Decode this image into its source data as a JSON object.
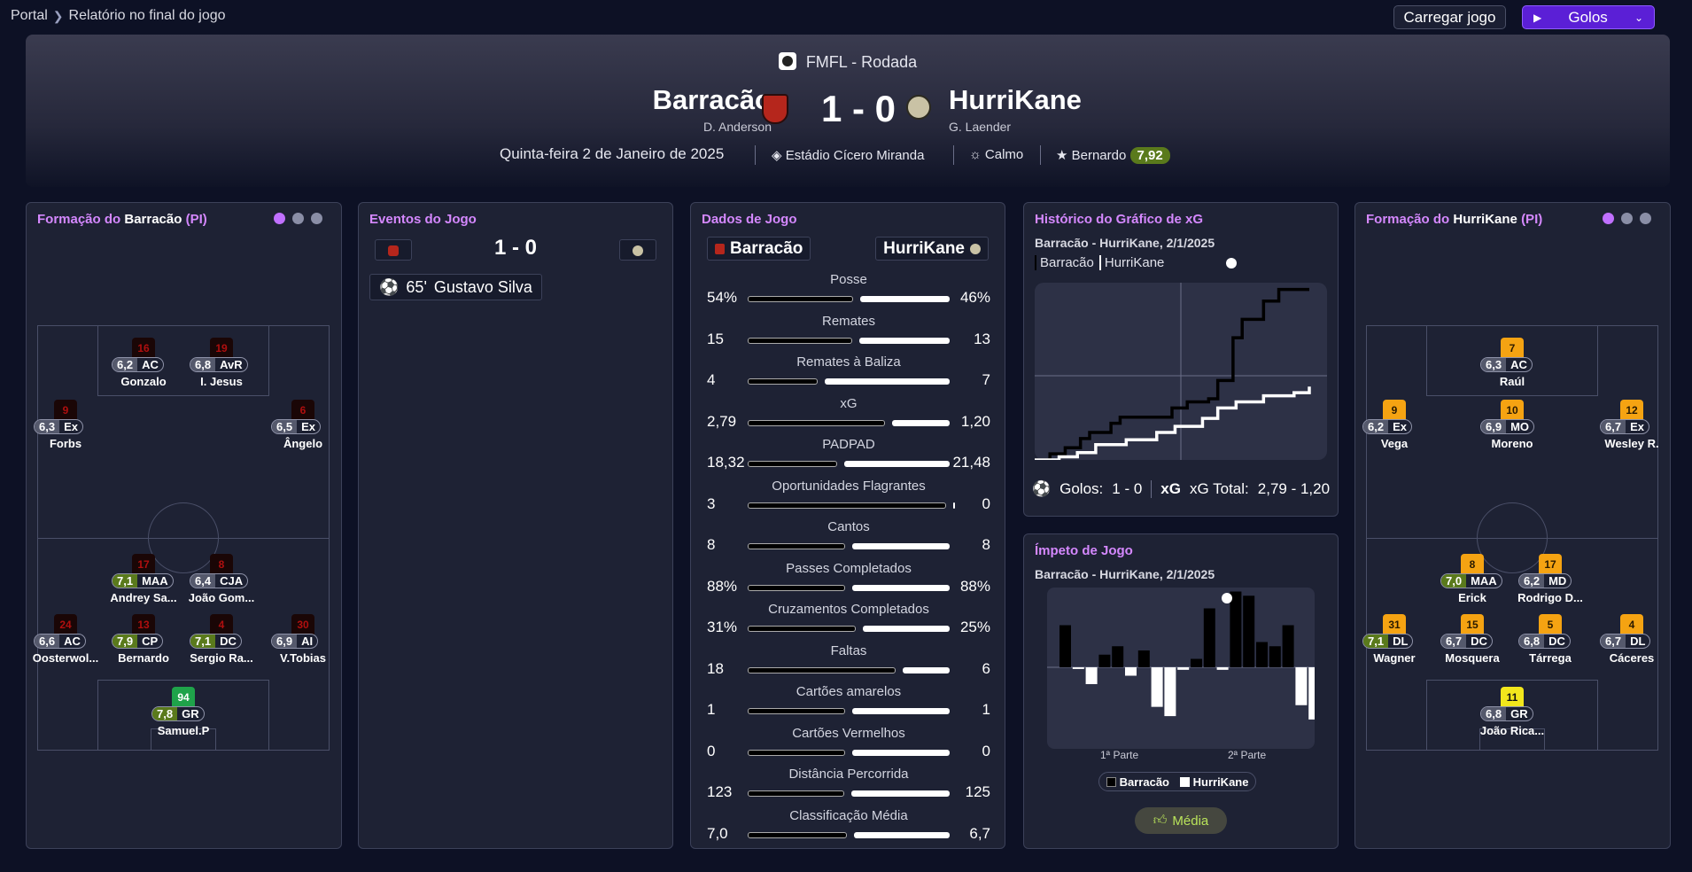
{
  "breadcrumb": {
    "root": "Portal",
    "current": "Relatório no final do jogo"
  },
  "toolbar": {
    "load_label": "Carregar jogo",
    "goals_label": "Golos"
  },
  "match": {
    "competition": "FMFL - Rodada",
    "home": {
      "name": "Barracão",
      "manager": "D. Anderson"
    },
    "away": {
      "name": "HurriKane",
      "manager": "G. Laender"
    },
    "score": "1 - 0",
    "date": "Quinta-feira 2 de Janeiro de 2025",
    "stadium": "Estádio Cícero Miranda",
    "weather": "Calmo",
    "potm": "Bernardo",
    "potm_rating": "7,92"
  },
  "colors": {
    "accent": "#5b1fd6",
    "title_purple": "#d588ff",
    "good_rating": "#5a7a1c"
  },
  "home_lineup": {
    "title_prefix": "Formação do",
    "team": "Barracão",
    "suffix": "(PI)",
    "players": [
      {
        "num": "16",
        "rating": "6,2",
        "pos": "AC",
        "name": "Gonzalo",
        "good": false
      },
      {
        "num": "19",
        "rating": "6,8",
        "pos": "AvR",
        "name": "I. Jesus",
        "good": false
      },
      {
        "num": "9",
        "rating": "6,3",
        "pos": "Ex",
        "name": "Forbs",
        "good": false
      },
      {
        "num": "6",
        "rating": "6,5",
        "pos": "Ex",
        "name": "Ângelo",
        "good": false
      },
      {
        "num": "17",
        "rating": "7,1",
        "pos": "MAA",
        "name": "Andrey Sa...",
        "good": true
      },
      {
        "num": "8",
        "rating": "6,4",
        "pos": "CJA",
        "name": "João Gom...",
        "good": false
      },
      {
        "num": "24",
        "rating": "6,6",
        "pos": "AC",
        "name": "Oosterwol...",
        "good": false
      },
      {
        "num": "13",
        "rating": "7,9",
        "pos": "CP",
        "name": "Bernardo",
        "good": true
      },
      {
        "num": "4",
        "rating": "7,1",
        "pos": "DC",
        "name": "Sergio Ra...",
        "good": true
      },
      {
        "num": "30",
        "rating": "6,9",
        "pos": "AI",
        "name": "V.Tobias",
        "good": false
      },
      {
        "num": "94",
        "rating": "7,8",
        "pos": "GR",
        "name": "Samuel.P",
        "good": true
      }
    ]
  },
  "away_lineup": {
    "title_prefix": "Formação do",
    "team": "HurriKane",
    "suffix": "(PI)",
    "players": [
      {
        "num": "7",
        "rating": "6,3",
        "pos": "AC",
        "name": "Raúl",
        "good": false
      },
      {
        "num": "9",
        "rating": "6,2",
        "pos": "Ex",
        "name": "Vega",
        "good": false
      },
      {
        "num": "10",
        "rating": "6,9",
        "pos": "MO",
        "name": "Moreno",
        "good": false
      },
      {
        "num": "12",
        "rating": "6,7",
        "pos": "Ex",
        "name": "Wesley R.",
        "good": false
      },
      {
        "num": "8",
        "rating": "7,0",
        "pos": "MAA",
        "name": "Erick",
        "good": true
      },
      {
        "num": "17",
        "rating": "6,2",
        "pos": "MD",
        "name": "Rodrigo D...",
        "good": false
      },
      {
        "num": "31",
        "rating": "7,1",
        "pos": "DL",
        "name": "Wagner",
        "good": true
      },
      {
        "num": "15",
        "rating": "6,7",
        "pos": "DC",
        "name": "Mosquera",
        "good": false
      },
      {
        "num": "5",
        "rating": "6,8",
        "pos": "DC",
        "name": "Tárrega",
        "good": false
      },
      {
        "num": "4",
        "rating": "6,7",
        "pos": "DL",
        "name": "Cáceres",
        "good": false
      },
      {
        "num": "11",
        "rating": "6,8",
        "pos": "GR",
        "name": "João Rica...",
        "good": false
      }
    ]
  },
  "events": {
    "title": "Eventos do Jogo",
    "score": "1 - 0",
    "items": [
      {
        "minute": "65'",
        "player": "Gustavo Silva"
      }
    ]
  },
  "stats": {
    "title": "Dados de Jogo",
    "home": "Barracão",
    "away": "HurriKane",
    "rows": [
      {
        "label": "Posse",
        "home": "54%",
        "away": "46%",
        "h": 54,
        "a": 46
      },
      {
        "label": "Remates",
        "home": "15",
        "away": "13",
        "h": 15,
        "a": 13
      },
      {
        "label": "Remates à Baliza",
        "home": "4",
        "away": "7",
        "h": 4,
        "a": 7
      },
      {
        "label": "xG",
        "home": "2,79",
        "away": "1,20",
        "h": 2.79,
        "a": 1.2
      },
      {
        "label": "PADPAD",
        "home": "18,32",
        "away": "21,48",
        "h": 18.32,
        "a": 21.48
      },
      {
        "label": "Oportunidades Flagrantes",
        "home": "3",
        "away": "0",
        "h": 3,
        "a": 0
      },
      {
        "label": "Cantos",
        "home": "8",
        "away": "8",
        "h": 8,
        "a": 8
      },
      {
        "label": "Passes Completados",
        "home": "88%",
        "away": "88%",
        "h": 88,
        "a": 88
      },
      {
        "label": "Cruzamentos Completados",
        "home": "31%",
        "away": "25%",
        "h": 31,
        "a": 25
      },
      {
        "label": "Faltas",
        "home": "18",
        "away": "6",
        "h": 18,
        "a": 6
      },
      {
        "label": "Cartões amarelos",
        "home": "1",
        "away": "1",
        "h": 1,
        "a": 1
      },
      {
        "label": "Cartões Vermelhos",
        "home": "0",
        "away": "0",
        "h": 0,
        "a": 0
      },
      {
        "label": "Distância Percorrida",
        "home": "123",
        "away": "125",
        "h": 123,
        "a": 125
      },
      {
        "label": "Classificação Média",
        "home": "7,0",
        "away": "6,7",
        "h": 7.0,
        "a": 6.7
      }
    ]
  },
  "xg_chart": {
    "title": "Histórico do Gráfico de xG",
    "subtitle": "Barracão - HurriKane, 2/1/2025",
    "legend": [
      "Barracão",
      "HurriKane"
    ],
    "footer_goals_label": "Golos:",
    "footer_goals": "1 - 0",
    "footer_xg_label": "xG Total:",
    "footer_xg": "2,79 - 1,20"
  },
  "momentum": {
    "title": "Ímpeto de Jogo",
    "subtitle": "Barracão - HurriKane, 2/1/2025",
    "half1": "1ª Parte",
    "half2": "2ª Parte",
    "legend": [
      "Barracão",
      "HurriKane"
    ],
    "button": "Média"
  },
  "chart_data": [
    {
      "type": "line",
      "title": "Histórico do Gráfico de xG",
      "series": [
        {
          "name": "Barracão",
          "x": [
            0,
            5,
            10,
            15,
            18,
            25,
            28,
            45,
            50,
            57,
            60,
            65,
            68,
            75,
            80,
            90
          ],
          "y": [
            0,
            0.1,
            0.2,
            0.35,
            0.45,
            0.6,
            0.7,
            0.85,
            0.95,
            1.0,
            1.3,
            2.0,
            2.3,
            2.6,
            2.79,
            2.79
          ]
        },
        {
          "name": "HurriKane",
          "x": [
            0,
            8,
            14,
            20,
            30,
            40,
            46,
            55,
            60,
            66,
            75,
            85,
            90
          ],
          "y": [
            0,
            0.05,
            0.12,
            0.25,
            0.33,
            0.45,
            0.55,
            0.68,
            0.85,
            0.95,
            1.05,
            1.1,
            1.2
          ]
        }
      ]
    },
    {
      "type": "bar",
      "title": "Ímpeto de Jogo",
      "values": [
        5,
        -0.2,
        -2,
        1.5,
        2.5,
        -1,
        2,
        -4.7,
        -5.8,
        -0.3,
        1,
        7,
        -0.3,
        9,
        8.5,
        3,
        2.5,
        5,
        -4.5,
        -6.2
      ]
    }
  ]
}
